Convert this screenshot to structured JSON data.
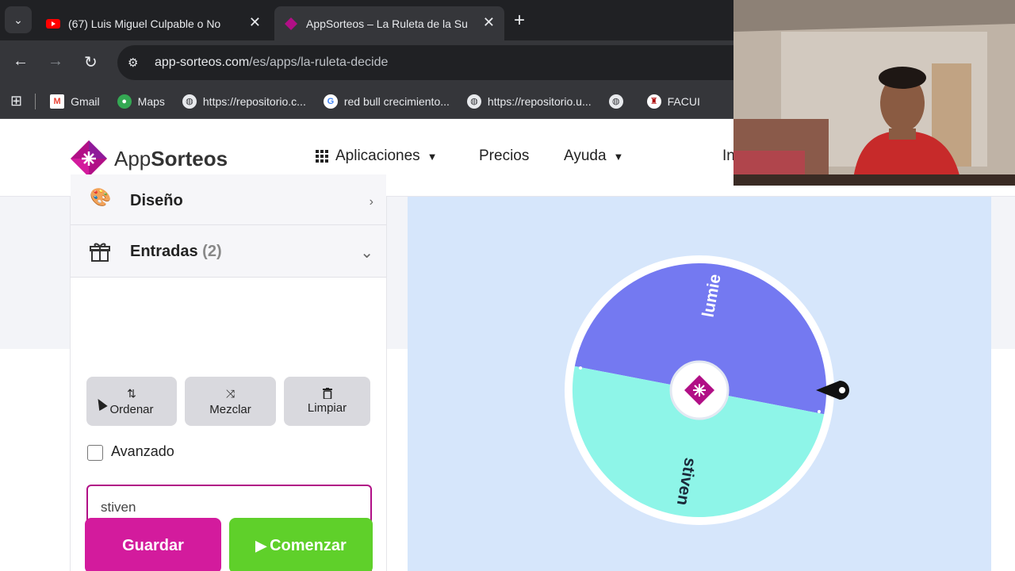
{
  "browser": {
    "tabs": [
      {
        "title": "(67) Luis Miguel Culpable o No",
        "close": "✕"
      },
      {
        "title": "AppSorteos – La Ruleta de la Su",
        "close": "✕"
      }
    ],
    "new_tab": "+",
    "tab_search": "⌄",
    "url_domain": "app-sorteos.com",
    "url_path": "/es/apps/la-ruleta-decide",
    "bookmarks": [
      {
        "label": "Gmail",
        "icon": "gmail-icon"
      },
      {
        "label": "Maps",
        "icon": "maps-icon"
      },
      {
        "label": "https://repositorio.c...",
        "icon": "globe-icon"
      },
      {
        "label": "red bull crecimiento...",
        "icon": "google-icon"
      },
      {
        "label": "https://repositorio.u...",
        "icon": "globe-icon"
      },
      {
        "label": "",
        "icon": "globe-icon"
      },
      {
        "label": "FACUI",
        "icon": "university-icon"
      }
    ]
  },
  "header": {
    "logo_app": "App",
    "logo_sorteos": "Sorteos",
    "nav": {
      "apps": "Aplicaciones",
      "prices": "Precios",
      "help": "Ayuda",
      "login": "In"
    }
  },
  "panel": {
    "design_label": "Diseño",
    "entries_label": "Entradas",
    "entries_count": "(2)",
    "sort_label": "Ordenar",
    "shuffle_label": "Mezclar",
    "clear_label": "Limpiar",
    "advanced_label": "Avanzado",
    "entries": [
      "stiven",
      "lumie"
    ],
    "save_label": "Guardar",
    "start_label": "Comenzar"
  },
  "wheel": {
    "segments": [
      {
        "label": "lumie",
        "color": "#7479f1"
      },
      {
        "label": "stiven",
        "color": "#8ef5e8"
      }
    ]
  },
  "colors": {
    "brand": "#b10f86",
    "save": "#d31b9d",
    "start": "#5fd02a",
    "stage": "#d6e6fb"
  }
}
